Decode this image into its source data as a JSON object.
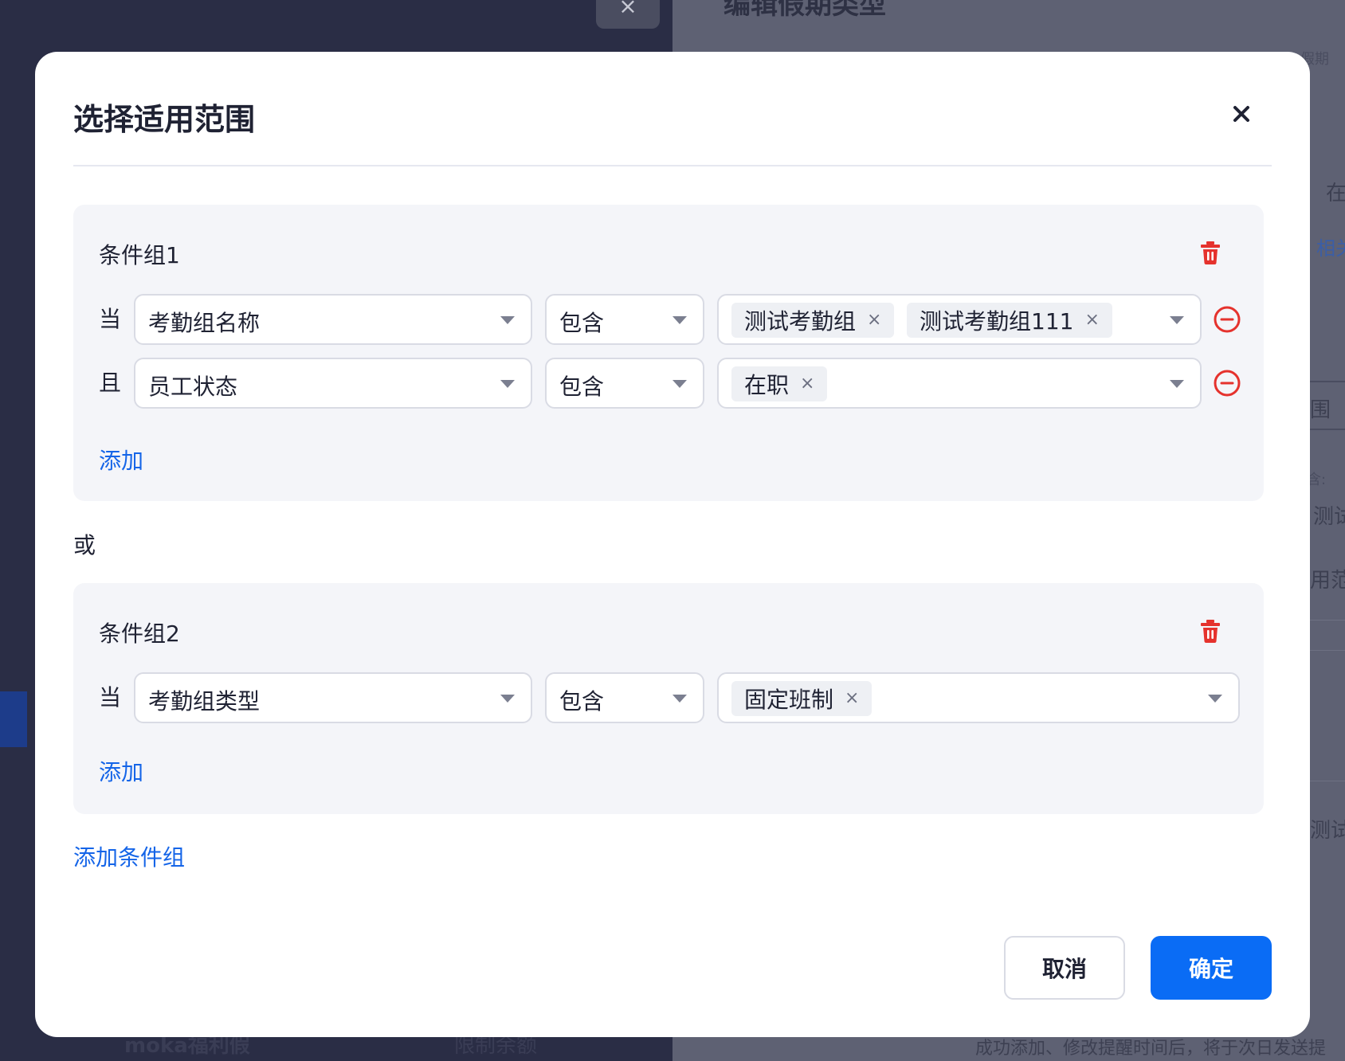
{
  "background": {
    "close_symbol": "×",
    "page_title": "编辑假期类型",
    "fragment_1": "假期",
    "fragment_2": "在",
    "fragment_3": "相关",
    "fragment_4": "围",
    "fragment_5": "含:",
    "fragment_6": "测试",
    "fragment_7": "用范",
    "fragment_8": "测试",
    "bottom_left_1": "moka福利假",
    "bottom_left_2": "限制余额",
    "bottom_right": "成功添加、修改提醒时间后，将于次日发送提"
  },
  "modal": {
    "title": "选择适用范围",
    "close_icon": "close-icon",
    "or_label": "或",
    "add_group_label": "添加条件组",
    "cancel_label": "取消",
    "confirm_label": "确定"
  },
  "groups": [
    {
      "title": "条件组1",
      "add_label": "添加",
      "conditions": [
        {
          "connector": "当",
          "field": "考勤组名称",
          "operator": "包含",
          "values": [
            "测试考勤组",
            "测试考勤组111"
          ]
        },
        {
          "connector": "且",
          "field": "员工状态",
          "operator": "包含",
          "values": [
            "在职"
          ]
        }
      ]
    },
    {
      "title": "条件组2",
      "add_label": "添加",
      "conditions": [
        {
          "connector": "当",
          "field": "考勤组类型",
          "operator": "包含",
          "values": [
            "固定班制"
          ]
        }
      ]
    }
  ],
  "tag_remove_symbol": "×",
  "colors": {
    "primary": "#0a6cf5",
    "danger": "#e5322d",
    "group_bg": "#f4f5f9",
    "overlay_left": "#2a2d45",
    "overlay_right": "#5e6173"
  }
}
